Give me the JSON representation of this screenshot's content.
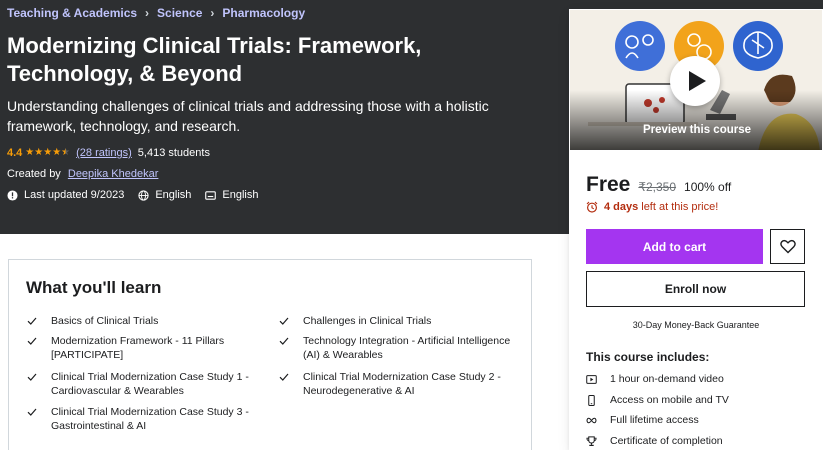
{
  "breadcrumb": {
    "items": [
      "Teaching & Academics",
      "Science",
      "Pharmacology"
    ],
    "separator": "›"
  },
  "course": {
    "title": "Modernizing Clinical Trials: Framework, Technology, & Beyond",
    "subtitle": "Understanding challenges of clinical trials and addressing those with a holistic framework, technology, and research.",
    "rating": "4.4",
    "stars": 4.5,
    "rating_count": "(28 ratings)",
    "students": "5,413 students",
    "created_by_label": "Created by",
    "instructor": "Deepika Khedekar",
    "last_updated": "Last updated 9/2023",
    "language": "English",
    "captions": "English"
  },
  "learn": {
    "title": "What you'll learn",
    "items": [
      "Basics of Clinical Trials",
      "Challenges in Clinical Trials",
      "Modernization Framework - 11 Pillars [PARTICIPATE]",
      "Technology Integration - Artificial Intelligence (AI) & Wearables",
      "Clinical Trial Modernization Case Study 1 - Cardiovascular & Wearables",
      "Clinical Trial Modernization Case Study 2 - Neurodegenerative & AI",
      "Clinical Trial Modernization Case Study 3 - Gastrointestinal & AI"
    ]
  },
  "sidebar": {
    "preview_label": "Preview this course",
    "price": "Free",
    "original_price": "₹2,350",
    "discount": "100% off",
    "deadline_bold": "4 days",
    "deadline_rest": "left at this price!",
    "add_to_cart": "Add to cart",
    "enroll": "Enroll now",
    "guarantee": "30-Day Money-Back Guarantee",
    "includes_title": "This course includes:",
    "includes": [
      {
        "icon": "video-icon",
        "text": "1 hour on-demand video"
      },
      {
        "icon": "mobile-icon",
        "text": "Access on mobile and TV"
      },
      {
        "icon": "infinity-icon",
        "text": "Full lifetime access"
      },
      {
        "icon": "trophy-icon",
        "text": "Certificate of completion"
      }
    ]
  },
  "colors": {
    "hero_bg": "#2d2f31",
    "accent_purple": "#a435f0",
    "link_lilac": "#c0c4fc",
    "star_orange": "#f69c08",
    "deadline_red": "#b32d0f"
  }
}
